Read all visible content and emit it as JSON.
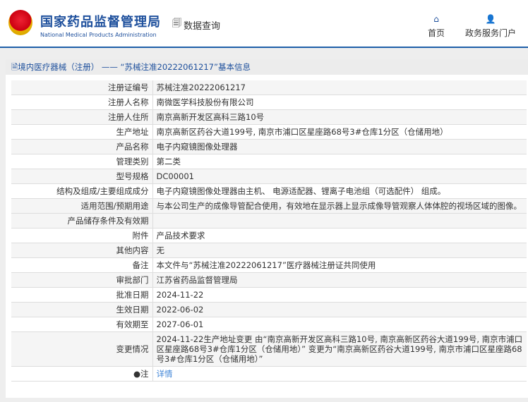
{
  "header": {
    "title_cn": "国家药品监督管理局",
    "title_en": "National Medical Products Administration",
    "query": "数据查询",
    "nav": [
      {
        "label": "首页",
        "icon": "home-icon"
      },
      {
        "label": "政务服务门户",
        "icon": "user-icon"
      }
    ]
  },
  "panel_title": "境内医疗器械（注册） —— “苏械注准20222061217”基本信息",
  "rows": [
    {
      "k": "注册证编号",
      "v": "苏械注准20222061217"
    },
    {
      "k": "注册人名称",
      "v": "南微医学科技股份有限公司"
    },
    {
      "k": "注册人住所",
      "v": "南京高新开发区高科三路10号"
    },
    {
      "k": "生产地址",
      "v": "南京高新区药谷大道199号, 南京市浦口区星座路68号3#仓库1分区（仓储用地）"
    },
    {
      "k": "产品名称",
      "v": "电子内窥镜图像处理器"
    },
    {
      "k": "管理类别",
      "v": "第二类"
    },
    {
      "k": "型号规格",
      "v": "DC00001"
    },
    {
      "k": "结构及组成/主要组成成分",
      "v": "电子内窥镜图像处理器由主机、 电源适配器、锂离子电池组（可选配件） 组成。"
    },
    {
      "k": "适用范围/预期用途",
      "v": "与本公司生产的成像导管配合使用，有效地在显示器上显示成像导管观察人体体腔的视场区域的图像。"
    },
    {
      "k": "产品储存条件及有效期",
      "v": ""
    },
    {
      "k": "附件",
      "v": "产品技术要求"
    },
    {
      "k": "其他内容",
      "v": "无"
    },
    {
      "k": "备注",
      "v": "本文件与“苏械注准20222061217”医疗器械注册证共同使用"
    },
    {
      "k": "审批部门",
      "v": "江苏省药品监督管理局"
    },
    {
      "k": "批准日期",
      "v": "2024-11-22"
    },
    {
      "k": "生效日期",
      "v": "2022-06-02"
    },
    {
      "k": "有效期至",
      "v": "2027-06-01"
    },
    {
      "k": "变更情况",
      "v": "2024-11-22生产地址变更 由“南京高新开发区高科三路10号, 南京高新区药谷大道199号, 南京市浦口区星座路68号3#仓库1分区（仓储用地）” 变更为“南京高新区药谷大道199号, 南京市浦口区星座路68号3#仓库1分区（仓储用地）”"
    }
  ],
  "note": {
    "label": "注",
    "link": "详情"
  }
}
